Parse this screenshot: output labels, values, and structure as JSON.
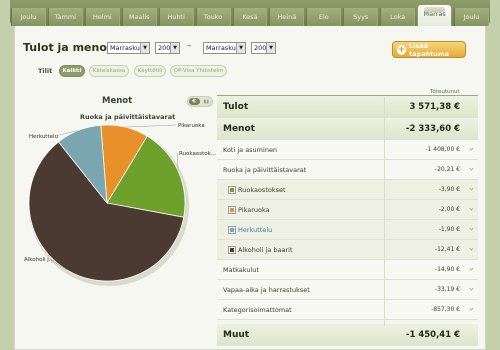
{
  "months": [
    "Joulu",
    "Tammi",
    "Helmi",
    "Maalis",
    "Huhti",
    "Touko",
    "Kesä",
    "Heinä",
    "Elo",
    "Syys",
    "Loka",
    "Marras",
    "Joulu"
  ],
  "active_month_index": 11,
  "header": {
    "title": "Tulot ja menot",
    "from_month": "Marraskuu",
    "from_year": "2009",
    "to_month": "Marraskuu",
    "to_year": "2009",
    "dash": "–",
    "add_button": "Lisää tapahtuma",
    "accounts_label": "Tilit",
    "accounts": [
      "Kaikki",
      "Käteiskassa",
      "Käyttötili",
      "OP-Visa Yhdistelm"
    ]
  },
  "chart": {
    "title": "Menot",
    "subtitle": "Ruoka ja päivittäistavarat"
  },
  "chart_data": {
    "type": "pie",
    "title": "Ruoka ja päivittäistavarat",
    "slices": [
      {
        "label": "Pikaruoka",
        "value": 2.0,
        "color": "#e8902a"
      },
      {
        "label": "Ruokaostok...",
        "value": 3.9,
        "color": "#6ea12c"
      },
      {
        "label": "Alkoholi j...",
        "value": 12.41,
        "color": "#4a3a31"
      },
      {
        "label": "Herkuttelu",
        "value": 1.9,
        "color": "#7aa6b0"
      }
    ]
  },
  "table": {
    "column_header": "Toteutunut",
    "rows": [
      {
        "label": "Tulot",
        "value": "3 571,38 €",
        "kind": "big"
      },
      {
        "label": "Menot",
        "value": "-2 333,60 €",
        "kind": "big"
      },
      {
        "label": "Koti ja asuminen",
        "value": "-1 408,00 €",
        "kind": "norm"
      },
      {
        "label": "Ruoka ja päivittäistavarat",
        "value": "-20,21 €",
        "kind": "norm"
      },
      {
        "label": "Ruokaostokset",
        "value": "-3,90 €",
        "kind": "sub",
        "swatch": "#6ea12c"
      },
      {
        "label": "Pikaruoka",
        "value": "-2,00 €",
        "kind": "sub",
        "swatch": "#e8902a"
      },
      {
        "label": "Herkuttelu",
        "value": "-1,90 €",
        "kind": "sub",
        "swatch": "#7aa6b0",
        "link": true
      },
      {
        "label": "Alkoholi ja baarit",
        "value": "-12,41 €",
        "kind": "sub",
        "swatch": "#4a3a31"
      },
      {
        "label": "Matkakulut",
        "value": "-14,90 €",
        "kind": "norm"
      },
      {
        "label": "Vapaa-aika ja harrastukset",
        "value": "-33,19 €",
        "kind": "norm"
      },
      {
        "label": "Kategorisoimattomat",
        "value": "-857,30 €",
        "kind": "norm"
      },
      {
        "label": "Muut",
        "value": "-1 450,41 €",
        "kind": "big"
      }
    ]
  }
}
